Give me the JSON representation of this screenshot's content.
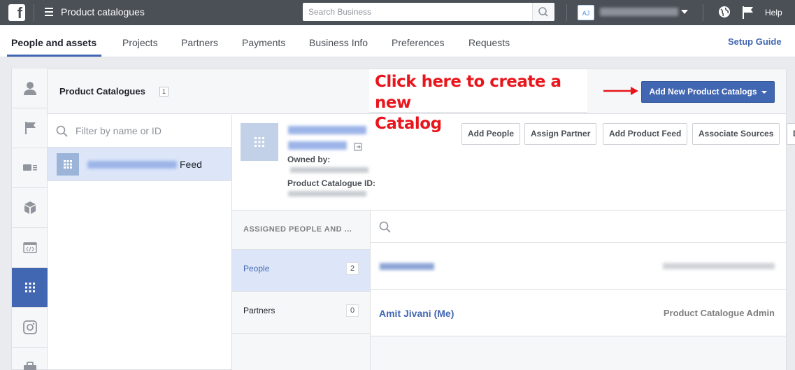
{
  "topbar": {
    "app_title": "Product catalogues",
    "search_placeholder": "Search Business",
    "avatar_initials": "AJ",
    "help_label": "Help"
  },
  "nav": {
    "tabs": [
      {
        "label": "People and assets",
        "active": true
      },
      {
        "label": "Projects"
      },
      {
        "label": "Partners"
      },
      {
        "label": "Payments"
      },
      {
        "label": "Business Info"
      },
      {
        "label": "Preferences"
      },
      {
        "label": "Requests"
      }
    ],
    "setup_guide": "Setup Guide"
  },
  "rail": {
    "items": [
      {
        "icon": "person-icon"
      },
      {
        "icon": "flag-icon"
      },
      {
        "icon": "ad-account-icon"
      },
      {
        "icon": "cube-icon"
      },
      {
        "icon": "code-icon"
      },
      {
        "icon": "grid-icon",
        "active": true
      },
      {
        "icon": "instagram-icon"
      },
      {
        "icon": "briefcase-icon"
      }
    ]
  },
  "panel": {
    "title": "Product Catalogues",
    "count": "1",
    "add_button": "Add New Product Catalogs",
    "annotation_line1": "Click here to create a new",
    "annotation_line2": "Catalog",
    "filter_placeholder": "Filter by name or ID",
    "feed_item_suffix": "Feed"
  },
  "detail": {
    "owned_by_label": "Owned by:",
    "catalogue_id_label": "Product Catalogue ID:",
    "actions": [
      "Add People",
      "Assign Partner",
      "Add Product Feed",
      "Associate Sources",
      "Delete"
    ]
  },
  "assigned": {
    "header": "ASSIGNED PEOPLE AND ...",
    "items": [
      {
        "label": "People",
        "count": "2",
        "active": true
      },
      {
        "label": "Partners",
        "count": "0"
      }
    ]
  },
  "people": {
    "rows": [
      {
        "name": "",
        "role": ""
      },
      {
        "name": "Amit Jivani (Me)",
        "role": "Product Catalogue Admin"
      }
    ]
  },
  "colors": {
    "accent": "#4267b2",
    "topbar": "#4b4f56",
    "annotation": "#e8161c"
  }
}
